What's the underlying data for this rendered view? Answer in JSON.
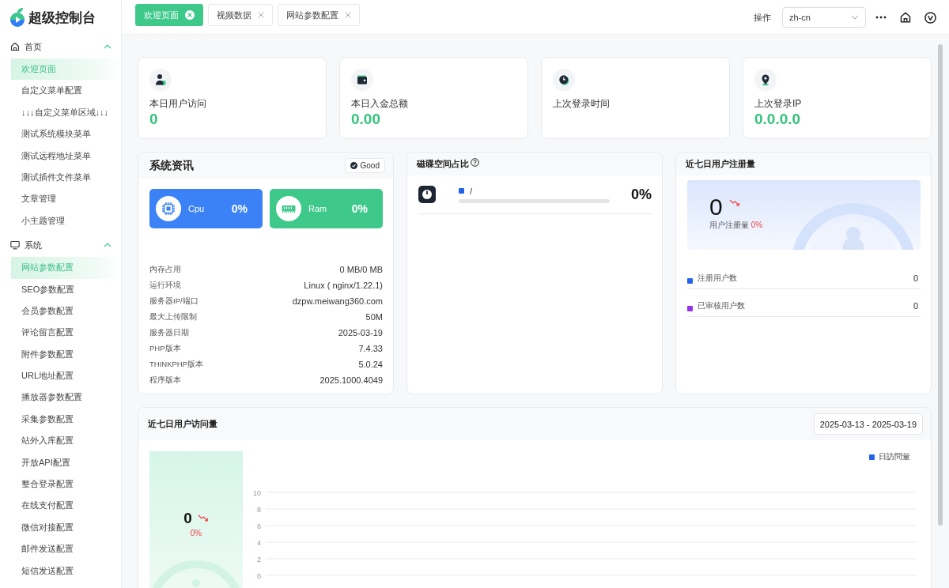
{
  "app": {
    "title": "超级控制台"
  },
  "sidebar": {
    "groups": [
      {
        "label": "首页",
        "expanded": true,
        "items": [
          {
            "label": "欢迎页面",
            "selected": true
          },
          {
            "label": "自定义菜单配置",
            "selected": false
          },
          {
            "label": "↓↓↓自定义菜单区域↓↓↓",
            "selected": false
          },
          {
            "label": "测试系统模块菜单",
            "selected": false
          },
          {
            "label": "测试远程地址菜单",
            "selected": false
          },
          {
            "label": "测试插件文件菜单",
            "selected": false
          },
          {
            "label": "文章管理",
            "selected": false
          },
          {
            "label": "小主题管理",
            "selected": false
          }
        ]
      },
      {
        "label": "系统",
        "expanded": true,
        "items": [
          {
            "label": "网站参数配置",
            "selected": true
          },
          {
            "label": "SEO参数配置",
            "selected": false
          },
          {
            "label": "会员参数配置",
            "selected": false
          },
          {
            "label": "评论留言配置",
            "selected": false
          },
          {
            "label": "附件参数配置",
            "selected": false
          },
          {
            "label": "URL地址配置",
            "selected": false
          },
          {
            "label": "播放器参数配置",
            "selected": false
          },
          {
            "label": "采集参数配置",
            "selected": false
          },
          {
            "label": "站外入库配置",
            "selected": false
          },
          {
            "label": "开放API配置",
            "selected": false
          },
          {
            "label": "整合登录配置",
            "selected": false
          },
          {
            "label": "在线支付配置",
            "selected": false
          },
          {
            "label": "微信对接配置",
            "selected": false
          },
          {
            "label": "邮件发送配置",
            "selected": false
          },
          {
            "label": "短信发送配置",
            "selected": false
          }
        ]
      }
    ]
  },
  "tabs": [
    {
      "label": "欢迎页面",
      "selected": true
    },
    {
      "label": "视频数据",
      "selected": false
    },
    {
      "label": "网站参数配置",
      "selected": false
    }
  ],
  "toolbar": {
    "operations": "操作",
    "language": "zh-cn"
  },
  "stats": [
    {
      "label": "本日用户访问",
      "value": "0"
    },
    {
      "label": "本日入金总额",
      "value": "0.00"
    },
    {
      "label": "上次登录时间"
    },
    {
      "label": "上次登录IP",
      "value": "0.0.0.0"
    }
  ],
  "system_info": {
    "title": "系统资讯",
    "status": "Good",
    "meters": [
      {
        "label": "Cpu",
        "value": "0%",
        "color": "#3b82f6"
      },
      {
        "label": "Ram",
        "value": "0%",
        "color": "#3ec98b"
      }
    ],
    "rows": [
      {
        "label": "内存占用",
        "value": "0 MB/0 MB"
      },
      {
        "label": "运行环境",
        "value": "Linux ( nginx/1.22.1)"
      },
      {
        "label": "服务器IP/端口",
        "value": "dzpw.meiwang360.com"
      },
      {
        "label": "最大上传限制",
        "value": "50M"
      },
      {
        "label": "服务器日期",
        "value": "2025-03-19"
      },
      {
        "label": "PHP版本",
        "value": "7.4.33"
      },
      {
        "label": "THINKPHP版本",
        "value": "5.0.24"
      },
      {
        "label": "程序版本",
        "value": "2025.1000.4049"
      }
    ]
  },
  "disk": {
    "title": "磁碟空间占比",
    "partitions": [
      {
        "name": "/",
        "level": 0,
        "usage": "0%"
      }
    ]
  },
  "register": {
    "title": "近七日用户注册量",
    "total": "0",
    "declining": true,
    "caption": "用户注册量",
    "change": "0%",
    "stats": [
      {
        "label": "注册用户数",
        "value": "0",
        "color": "#2563eb"
      },
      {
        "label": "已审核用户数",
        "value": "0",
        "color": "#9333ea"
      }
    ]
  },
  "visits": {
    "title": "近七日用户访问量",
    "date_range": "2025-03-13 - 2025-03-19",
    "summary": {
      "total": "0",
      "declining": true,
      "change": "0%"
    },
    "chart_data": {
      "type": "line",
      "grid": true,
      "ylim": [
        0,
        10
      ],
      "yticks": [
        0,
        2,
        4,
        6,
        8,
        10
      ],
      "series": [
        {
          "name": "日訪問量",
          "color": "#2563eb"
        }
      ]
    }
  }
}
